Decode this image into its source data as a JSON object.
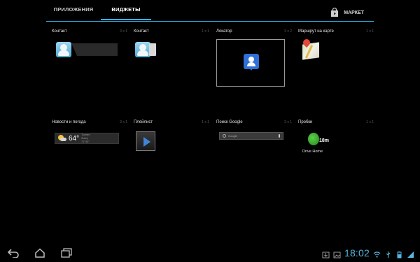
{
  "tabs": {
    "apps": "ПРИЛОЖЕНИЯ",
    "widgets": "ВИДЖЕТЫ",
    "market": "МАРКЕТ"
  },
  "widgets": [
    {
      "name": "Контакт",
      "size": "3 x 1"
    },
    {
      "name": "Контакт",
      "size": "1 x 1"
    },
    {
      "name": "Локатор",
      "size": "3 x 2"
    },
    {
      "name": "Маршрут на карте",
      "size": "1 x 1"
    },
    {
      "name": "Новости и погода",
      "size": "3 x 1"
    },
    {
      "name": "Плейлист",
      "size": "1 x 1"
    },
    {
      "name": "Поиск Google",
      "size": "3 x 1"
    },
    {
      "name": "Пробки",
      "size": "1 x 1"
    }
  ],
  "weather": {
    "temp": "64°",
    "line1": "Tyumen",
    "line2": "Sunny",
    "line3": "71° 54°"
  },
  "search": {
    "placeholder": "Google"
  },
  "traffic": {
    "minutes": "18m",
    "label": "Drive Home"
  },
  "status": {
    "time": "18:02"
  },
  "colors": {
    "accent": "#33b5e5",
    "clock": "#58b6e0",
    "background": "#000000"
  }
}
